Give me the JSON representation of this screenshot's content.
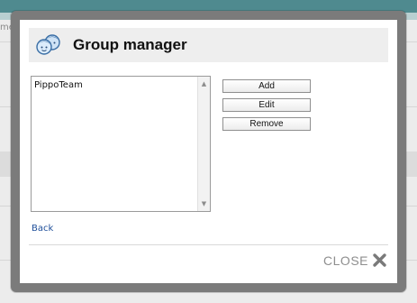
{
  "background": {
    "fragment_text": "me"
  },
  "modal": {
    "title": "Group manager",
    "header_icon": "users-group-icon",
    "groups": [
      "PippoTeam"
    ],
    "buttons": {
      "add": "Add",
      "edit": "Edit",
      "remove": "Remove"
    },
    "back_link": "Back",
    "close_label": "CLOSE",
    "close_icon": "close-icon"
  },
  "colors": {
    "overlay_frame": "#7b7b7b",
    "header_bg": "#eeeeee",
    "link": "#1f4f9a",
    "close_text": "#8e8e8e",
    "bg_topbar": "#4f8a8f"
  }
}
